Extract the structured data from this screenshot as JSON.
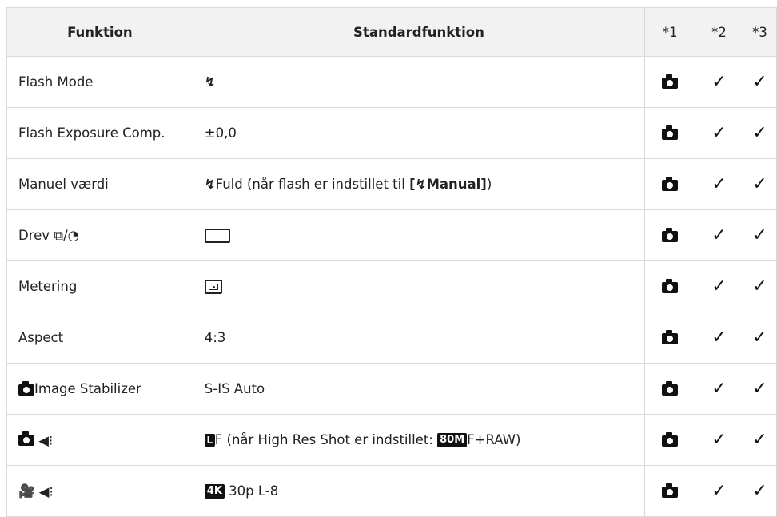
{
  "header": {
    "col1": "Funktion",
    "col2": "Standardfunktion",
    "col3": "*1",
    "col4": "*2",
    "col5": "*3"
  },
  "rows": {
    "r0": {
      "label": "Flash Mode",
      "value_icon": "flash-icon"
    },
    "r1": {
      "label": "Flash Exposure Comp.",
      "value": "±0,0"
    },
    "r2": {
      "label": "Manuel værdi",
      "value_prefix": "Fuld (når flash er indstillet til ",
      "value_bracket_open": "[",
      "value_bold": "Manual",
      "value_bracket_close": "]",
      "value_suffix": ")"
    },
    "r3": {
      "label": "Drev",
      "label_sep": "/",
      "value_icon": "single-frame-icon"
    },
    "r4": {
      "label": "Metering",
      "value_icon": "metering-icon"
    },
    "r5": {
      "label": "Aspect",
      "value": "4:3"
    },
    "r6": {
      "label": "Image Stabilizer",
      "value": "S-IS Auto"
    },
    "r7": {
      "value_prefix": "F (når High Res Shot er indstillet: ",
      "badge": "80M",
      "value_suffix": "F+RAW)"
    },
    "r8": {
      "badge": "4K",
      "value": "30p L-8"
    }
  },
  "check_glyph": "✓"
}
